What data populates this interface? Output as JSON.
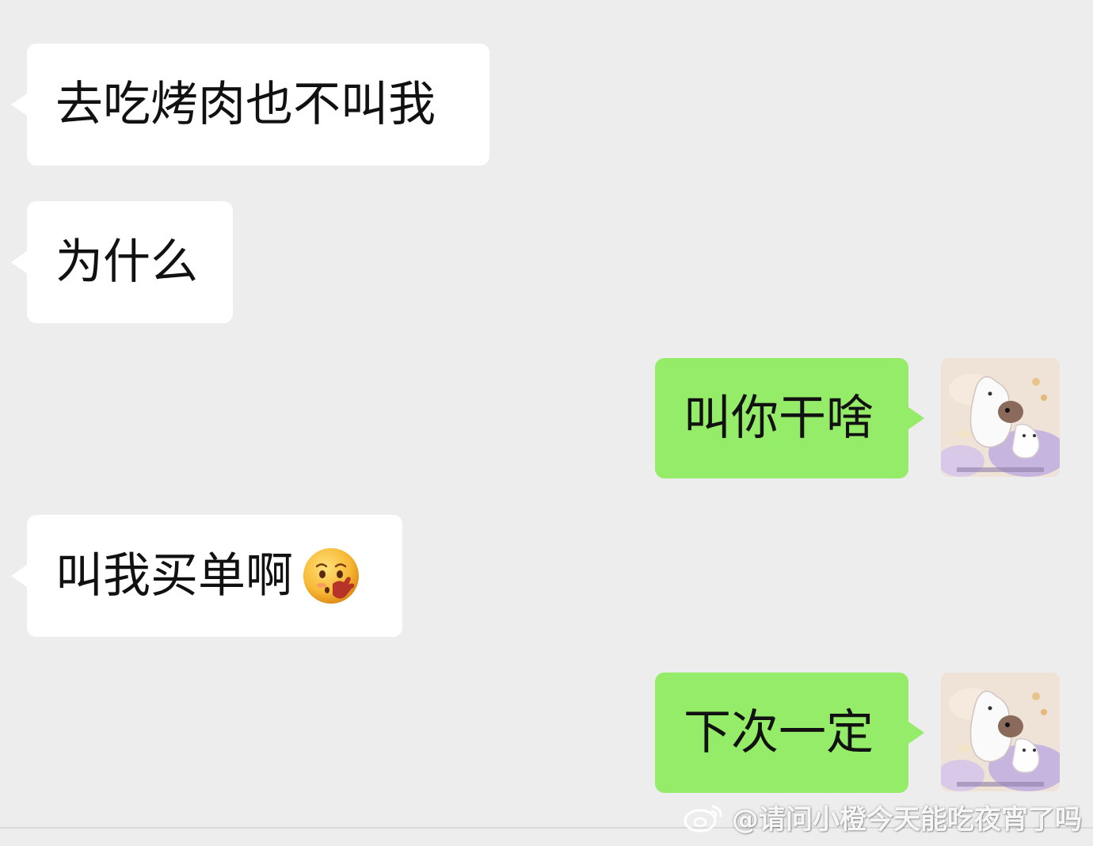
{
  "messages": [
    {
      "side": "incoming",
      "text": "去吃烤肉也不叫我"
    },
    {
      "side": "incoming",
      "text": "为什么"
    },
    {
      "side": "outgoing",
      "text": "叫你干啥"
    },
    {
      "side": "incoming",
      "text": "叫我买单啊",
      "emoji": "face-with-hand-over-mouth-icon"
    },
    {
      "side": "outgoing",
      "text": "下次一定"
    }
  ],
  "watermark": {
    "text": "@请问小橙今天能吃夜宵了吗",
    "icon": "weibo-logo-icon"
  },
  "colors": {
    "background": "#ededed",
    "incoming_bubble": "#ffffff",
    "outgoing_bubble": "#95ec69"
  }
}
